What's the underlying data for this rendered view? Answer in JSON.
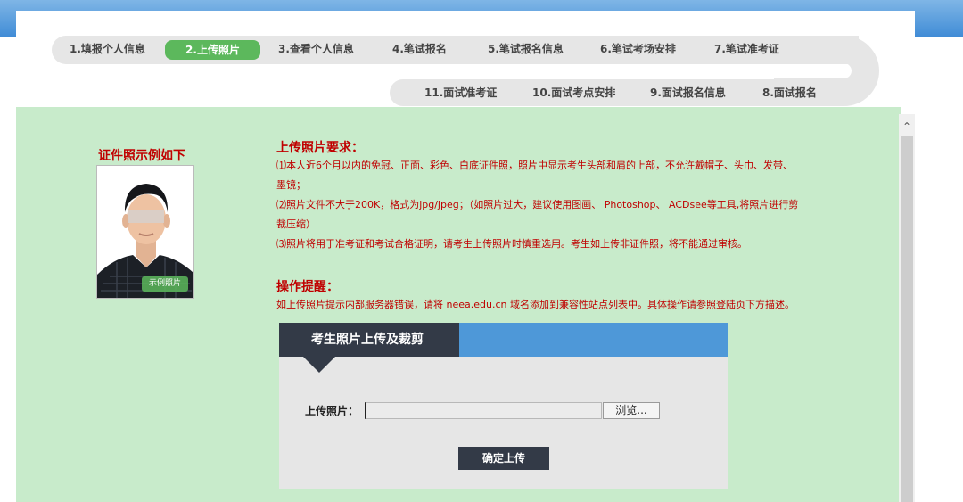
{
  "steps": {
    "s1": "1.填报个人信息",
    "s2": "2.上传照片",
    "s3": "3.查看个人信息",
    "s4": "4.笔试报名",
    "s5": "5.笔试报名信息",
    "s6": "6.笔试考场安排",
    "s7": "7.笔试准考证",
    "s8": "8.面试报名",
    "s9": "9.面试报名信息",
    "s10": "10.面试考点安排",
    "s11": "11.面试准考证"
  },
  "active_step": "2.上传照片",
  "example": {
    "title": "证件照示例如下",
    "badge": "示例照片"
  },
  "requirements": {
    "title": "上传照片要求：",
    "line1": "⑴本人近6个月以内的免冠、正面、彩色、白底证件照，照片中显示考生头部和肩的上部，不允许戴帽子、头巾、发带、",
    "line1b": "墨镜；",
    "line2": "⑵照片文件不大于200K，格式为jpg/jpeg；（如照片过大，建议使用图画、 Photoshop、 ACDsee等工具,将照片进行剪",
    "line2b": "裁压缩）",
    "line3": "⑶照片将用于准考证和考试合格证明，请考生上传照片时慎重选用。考生如上传非证件照，将不能通过审核。"
  },
  "tips": {
    "title": "操作提醒：",
    "line": "如上传照片提示内部服务器错误，请将 neea.edu.cn 域名添加到兼容性站点列表中。具体操作请参照登陆页下方描述。"
  },
  "upload": {
    "header": "考生照片上传及裁剪",
    "file_label": "上传照片：",
    "browse_label": "浏览...",
    "submit_label": "确定上传",
    "file_value": ""
  },
  "colors": {
    "accent_green": "#5cb85c",
    "panel_green": "#c8ebcb",
    "warning_red": "#c00000",
    "dark_header": "#333a47",
    "blue_bar": "#4e98d8"
  }
}
